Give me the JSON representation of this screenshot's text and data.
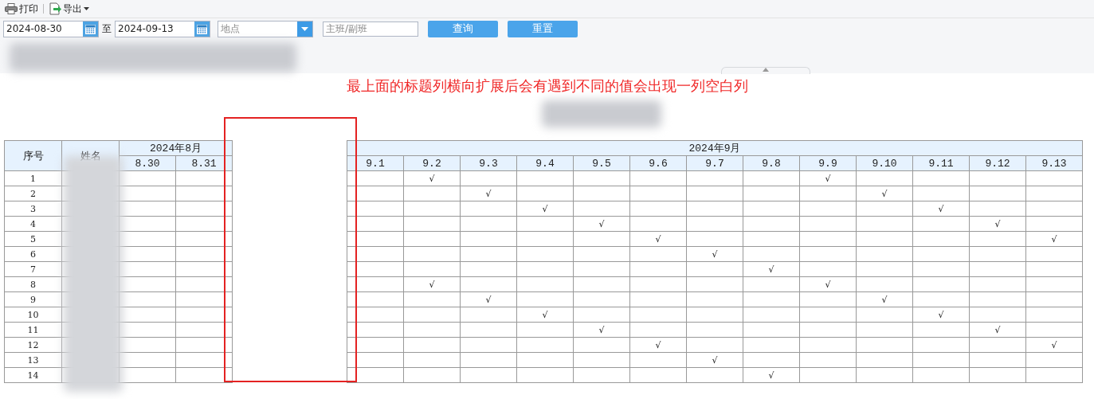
{
  "toolbar": [
    {
      "label": "打印",
      "kind": "print"
    },
    {
      "label": "导出",
      "kind": "export"
    }
  ],
  "filters": {
    "start_date": "2024-08-30",
    "separator": "至",
    "end_date": "2024-09-13",
    "location": {
      "placeholder": "地点"
    },
    "shift": {
      "placeholder": "主班/副班"
    }
  },
  "buttons": [
    "查询",
    "重置"
  ],
  "annotation": "最上面的标题列横向扩展后会有遇到不同的值会出现一列空白列",
  "table": {
    "columns": [
      "序号",
      "姓名"
    ],
    "month_groups": [
      {
        "label": "2024年8月",
        "days": [
          "8.30",
          "8.31"
        ]
      },
      {
        "label": "2024年9月",
        "days": [
          "9.1",
          "9.2",
          "9.3",
          "9.4",
          "9.5",
          "9.6",
          "9.7",
          "9.8",
          "9.9",
          "9.10",
          "9.11",
          "9.12",
          "9.13"
        ]
      }
    ],
    "rows": [
      {
        "no": "1",
        "cells": [
          {
            "checked": false
          },
          {
            "checked": false
          },
          {
            "checked": false
          },
          {
            "checked": true,
            "text": "√"
          },
          {
            "checked": false
          },
          {
            "checked": false
          },
          {
            "checked": false
          },
          {
            "checked": false
          },
          {
            "checked": false
          },
          {
            "checked": false
          },
          {
            "checked": true,
            "text": "√"
          },
          {
            "checked": false
          },
          {
            "checked": false
          },
          {
            "checked": false
          },
          {
            "checked": false
          }
        ]
      },
      {
        "no": "2",
        "cells": [
          {
            "checked": false
          },
          {
            "checked": false
          },
          {
            "checked": false
          },
          {
            "checked": false
          },
          {
            "checked": true,
            "text": "√"
          },
          {
            "checked": false
          },
          {
            "checked": false
          },
          {
            "checked": false
          },
          {
            "checked": false
          },
          {
            "checked": false
          },
          {
            "checked": false
          },
          {
            "checked": true,
            "text": "√"
          },
          {
            "checked": false
          },
          {
            "checked": false
          },
          {
            "checked": false
          }
        ]
      },
      {
        "no": "3",
        "cells": [
          {
            "checked": false
          },
          {
            "checked": false
          },
          {
            "checked": false
          },
          {
            "checked": false
          },
          {
            "checked": false
          },
          {
            "checked": true,
            "text": "√"
          },
          {
            "checked": false
          },
          {
            "checked": false
          },
          {
            "checked": false
          },
          {
            "checked": false
          },
          {
            "checked": false
          },
          {
            "checked": false
          },
          {
            "checked": true,
            "text": "√"
          },
          {
            "checked": false
          },
          {
            "checked": false
          }
        ]
      },
      {
        "no": "4",
        "cells": [
          {
            "checked": false
          },
          {
            "checked": false
          },
          {
            "checked": false
          },
          {
            "checked": false
          },
          {
            "checked": false
          },
          {
            "checked": false
          },
          {
            "checked": true,
            "text": "√"
          },
          {
            "checked": false
          },
          {
            "checked": false
          },
          {
            "checked": false
          },
          {
            "checked": false
          },
          {
            "checked": false
          },
          {
            "checked": false
          },
          {
            "checked": true,
            "text": "√"
          },
          {
            "checked": false
          }
        ]
      },
      {
        "no": "5",
        "cells": [
          {
            "checked": false
          },
          {
            "checked": false
          },
          {
            "checked": false
          },
          {
            "checked": false
          },
          {
            "checked": false
          },
          {
            "checked": false
          },
          {
            "checked": false
          },
          {
            "checked": true,
            "text": "√"
          },
          {
            "checked": false
          },
          {
            "checked": false
          },
          {
            "checked": false
          },
          {
            "checked": false
          },
          {
            "checked": false
          },
          {
            "checked": false
          },
          {
            "checked": true,
            "text": "√"
          }
        ]
      },
      {
        "no": "6",
        "cells": [
          {
            "checked": false
          },
          {
            "checked": false
          },
          {
            "checked": false
          },
          {
            "checked": false
          },
          {
            "checked": false
          },
          {
            "checked": false
          },
          {
            "checked": false
          },
          {
            "checked": false
          },
          {
            "checked": true,
            "text": "√"
          },
          {
            "checked": false
          },
          {
            "checked": false
          },
          {
            "checked": false
          },
          {
            "checked": false
          },
          {
            "checked": false
          },
          {
            "checked": false
          }
        ]
      },
      {
        "no": "7",
        "cells": [
          {
            "checked": false
          },
          {
            "checked": false
          },
          {
            "checked": false
          },
          {
            "checked": false
          },
          {
            "checked": false
          },
          {
            "checked": false
          },
          {
            "checked": false
          },
          {
            "checked": false
          },
          {
            "checked": false
          },
          {
            "checked": true,
            "text": "√"
          },
          {
            "checked": false
          },
          {
            "checked": false
          },
          {
            "checked": false
          },
          {
            "checked": false
          },
          {
            "checked": false
          }
        ]
      },
      {
        "no": "8",
        "cells": [
          {
            "checked": false
          },
          {
            "checked": false
          },
          {
            "checked": false
          },
          {
            "checked": true,
            "text": "√"
          },
          {
            "checked": false
          },
          {
            "checked": false
          },
          {
            "checked": false
          },
          {
            "checked": false
          },
          {
            "checked": false
          },
          {
            "checked": false
          },
          {
            "checked": true,
            "text": "√"
          },
          {
            "checked": false
          },
          {
            "checked": false
          },
          {
            "checked": false
          },
          {
            "checked": false
          }
        ]
      },
      {
        "no": "9",
        "cells": [
          {
            "checked": false
          },
          {
            "checked": false
          },
          {
            "checked": false
          },
          {
            "checked": false
          },
          {
            "checked": true,
            "text": "√"
          },
          {
            "checked": false
          },
          {
            "checked": false
          },
          {
            "checked": false
          },
          {
            "checked": false
          },
          {
            "checked": false
          },
          {
            "checked": false
          },
          {
            "checked": true,
            "text": "√"
          },
          {
            "checked": false
          },
          {
            "checked": false
          },
          {
            "checked": false
          }
        ]
      },
      {
        "no": "10",
        "cells": [
          {
            "checked": false
          },
          {
            "checked": false
          },
          {
            "checked": false
          },
          {
            "checked": false
          },
          {
            "checked": false
          },
          {
            "checked": true,
            "text": "√"
          },
          {
            "checked": false
          },
          {
            "checked": false
          },
          {
            "checked": false
          },
          {
            "checked": false
          },
          {
            "checked": false
          },
          {
            "checked": false
          },
          {
            "checked": true,
            "text": "√"
          },
          {
            "checked": false
          },
          {
            "checked": false
          }
        ]
      },
      {
        "no": "11",
        "cells": [
          {
            "checked": false
          },
          {
            "checked": false
          },
          {
            "checked": false
          },
          {
            "checked": false
          },
          {
            "checked": false
          },
          {
            "checked": false
          },
          {
            "checked": true,
            "text": "√"
          },
          {
            "checked": false
          },
          {
            "checked": false
          },
          {
            "checked": false
          },
          {
            "checked": false
          },
          {
            "checked": false
          },
          {
            "checked": false
          },
          {
            "checked": true,
            "text": "√"
          },
          {
            "checked": false
          }
        ]
      },
      {
        "no": "12",
        "cells": [
          {
            "checked": false
          },
          {
            "checked": false
          },
          {
            "checked": false
          },
          {
            "checked": false
          },
          {
            "checked": false
          },
          {
            "checked": false
          },
          {
            "checked": false
          },
          {
            "checked": true,
            "text": "√"
          },
          {
            "checked": false
          },
          {
            "checked": false
          },
          {
            "checked": false
          },
          {
            "checked": false
          },
          {
            "checked": false
          },
          {
            "checked": false
          },
          {
            "checked": true,
            "text": "√"
          }
        ]
      },
      {
        "no": "13",
        "cells": [
          {
            "checked": false
          },
          {
            "checked": false
          },
          {
            "checked": false
          },
          {
            "checked": false
          },
          {
            "checked": false
          },
          {
            "checked": false
          },
          {
            "checked": false
          },
          {
            "checked": false
          },
          {
            "checked": true,
            "text": "√"
          },
          {
            "checked": false
          },
          {
            "checked": false
          },
          {
            "checked": false
          },
          {
            "checked": false
          },
          {
            "checked": false
          },
          {
            "checked": false
          }
        ]
      },
      {
        "no": "14",
        "cells": [
          {
            "checked": false
          },
          {
            "checked": false
          },
          {
            "checked": false
          },
          {
            "checked": false
          },
          {
            "checked": false
          },
          {
            "checked": false
          },
          {
            "checked": false
          },
          {
            "checked": false
          },
          {
            "checked": false
          },
          {
            "checked": true,
            "text": "√"
          },
          {
            "checked": false
          },
          {
            "checked": false
          },
          {
            "checked": false
          },
          {
            "checked": false
          },
          {
            "checked": false
          }
        ]
      }
    ]
  }
}
